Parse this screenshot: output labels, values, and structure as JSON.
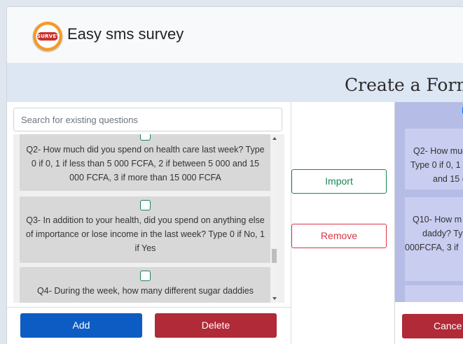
{
  "app": {
    "title": "Easy sms survey",
    "logo_text": "SURVEY"
  },
  "page": {
    "title": "Create a Form"
  },
  "search": {
    "placeholder": "Search for existing questions"
  },
  "questions": [
    {
      "text": "Q2- How much did you spend on health care last week? Type 0 if 0, 1 if less than 5 000 FCFA, 2 if between 5 000 and 15 000 FCFA, 3 if more than 15 000 FCFA",
      "checked": false
    },
    {
      "text": "Q3- In addition to your health, did you spend on anything else of importance or lose income in the last week? Type 0 if No, 1 if Yes",
      "checked": false
    },
    {
      "text": "Q4- During the week, how many different sugar daddies",
      "checked": false
    }
  ],
  "buttons": {
    "add": "Add",
    "delete": "Delete",
    "import": "Import",
    "remove": "Remove",
    "cancel": "Cance"
  },
  "right_panel": {
    "header": "D",
    "items": [
      {
        "lines": [
          "Q2- How muc",
          "Type 0 if 0, 1",
          "and 15 ("
        ]
      },
      {
        "lines": [
          "Q10- How m",
          "daddy? Ty",
          "000FCFA, 3 if"
        ]
      }
    ]
  },
  "colors": {
    "primary": "#0d5cc4",
    "danger": "#b02a37",
    "success": "#198754",
    "selected_bg": "#b5bde6"
  }
}
